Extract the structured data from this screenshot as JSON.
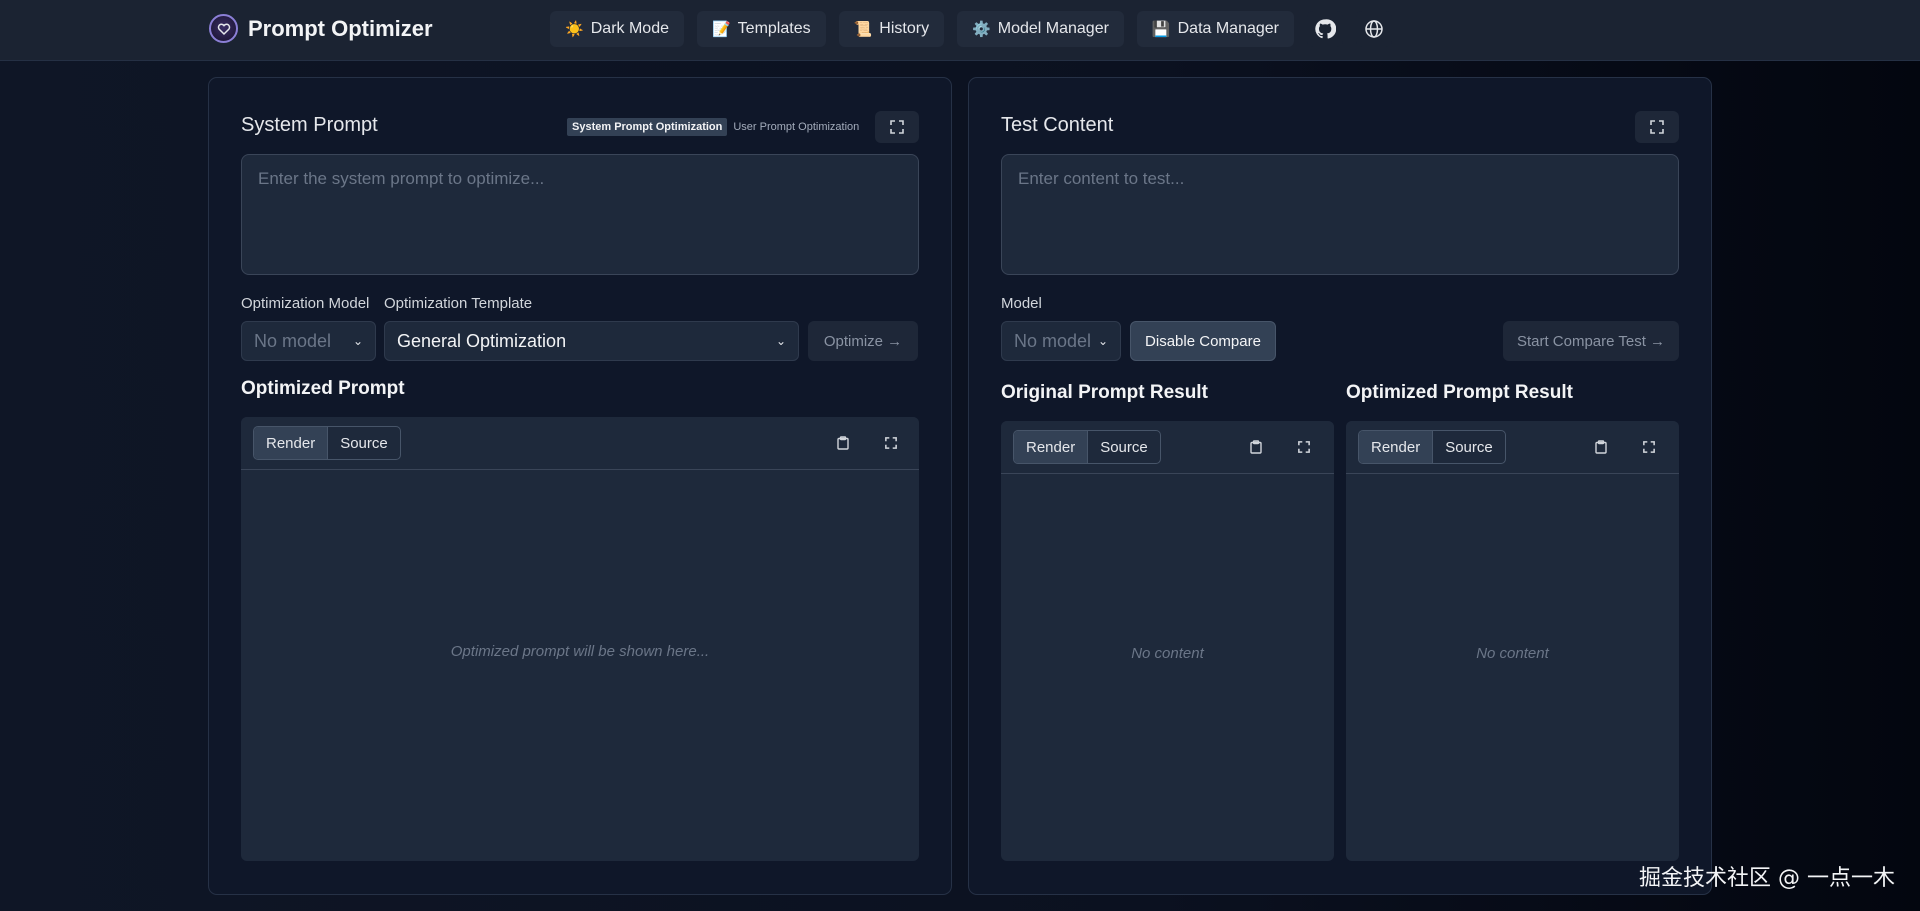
{
  "app": {
    "title": "Prompt Optimizer",
    "logo_icon": "heart-bubble-icon"
  },
  "nav": [
    {
      "label": "Dark Mode",
      "icon": "sun-icon"
    },
    {
      "label": "Templates",
      "icon": "document-icon"
    },
    {
      "label": "History",
      "icon": "scroll-icon"
    },
    {
      "label": "Model Manager",
      "icon": "gear-icon"
    },
    {
      "label": "Data Manager",
      "icon": "floppy-disk-icon"
    }
  ],
  "nav_icons": [
    {
      "icon": "github-icon"
    },
    {
      "icon": "globe-icon"
    }
  ],
  "left": {
    "title": "System Prompt",
    "mode_tabs": [
      {
        "label": "System Prompt Optimization",
        "active": true
      },
      {
        "label": "User Prompt Optimization",
        "active": false
      }
    ],
    "input_placeholder": "Enter the system prompt to optimize...",
    "model_label": "Optimization Model",
    "model_value": "No model",
    "template_label": "Optimization Template",
    "template_value": "General Optimization",
    "optimize_button": "Optimize →",
    "output_title": "Optimized Prompt",
    "render_tab": "Render",
    "source_tab": "Source",
    "output_empty": "Optimized prompt will be shown here..."
  },
  "right": {
    "title": "Test Content",
    "input_placeholder": "Enter content to test...",
    "model_label": "Model",
    "model_value": "No model",
    "disable_compare_button": "Disable Compare",
    "start_test_button": "Start Compare Test →",
    "original_title": "Original Prompt Result",
    "optimized_title": "Optimized Prompt Result",
    "render_tab": "Render",
    "source_tab": "Source",
    "empty_text": "No content"
  },
  "watermark": "掘金技术社区 @ 一点一木"
}
